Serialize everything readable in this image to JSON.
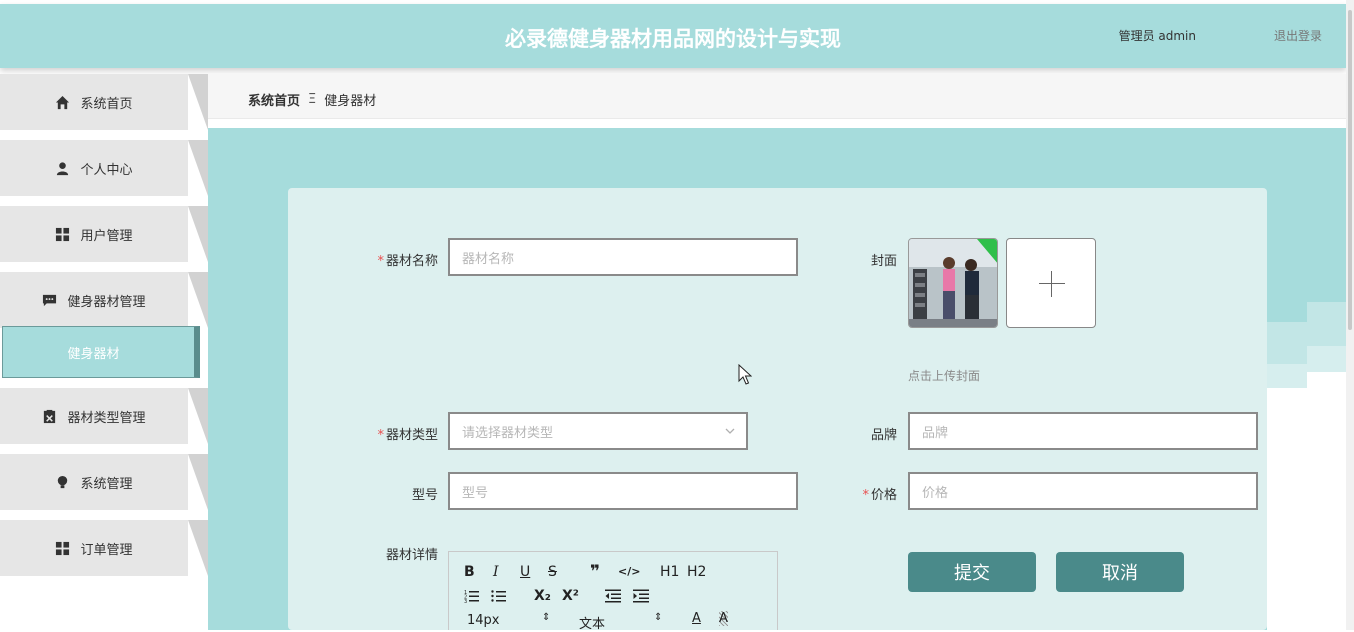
{
  "header": {
    "title": "必录德健身器材用品网的设计与实现",
    "user_label": "管理员 admin",
    "logout_label": "退出登录"
  },
  "sidebar": {
    "items": [
      {
        "label": "系统首页",
        "icon": "home-icon"
      },
      {
        "label": "个人中心",
        "icon": "user-icon"
      },
      {
        "label": "用户管理",
        "icon": "grid-icon"
      },
      {
        "label": "健身器材管理",
        "icon": "chat-icon"
      },
      {
        "label": "器材类型管理",
        "icon": "clipboard-icon"
      },
      {
        "label": "系统管理",
        "icon": "bulb-icon"
      },
      {
        "label": "订单管理",
        "icon": "grid-icon"
      }
    ],
    "active_sub_label": "健身器材"
  },
  "breadcrumb": {
    "home": "系统首页",
    "separator": "Ξ",
    "current": "健身器材"
  },
  "form": {
    "name": {
      "label": "器材名称",
      "placeholder": "器材名称",
      "required": true
    },
    "cover": {
      "label": "封面",
      "hint": "点击上传封面"
    },
    "type": {
      "label": "器材类型",
      "placeholder": "请选择器材类型",
      "required": true
    },
    "brand": {
      "label": "品牌",
      "placeholder": "品牌"
    },
    "model": {
      "label": "型号",
      "placeholder": "型号"
    },
    "price": {
      "label": "价格",
      "placeholder": "价格",
      "required": true
    },
    "detail": {
      "label": "器材详情"
    },
    "submit_label": "提交",
    "cancel_label": "取消",
    "required_mark": "*"
  },
  "editor": {
    "row1": [
      "B",
      "I",
      "U",
      "S",
      "❞",
      "</>",
      "H1",
      "H2"
    ],
    "row2": [
      "ordered-list",
      "bullet-list",
      "X₂",
      "X²",
      "outdent",
      "indent"
    ],
    "font_size": "14px",
    "block_type": "文本"
  }
}
